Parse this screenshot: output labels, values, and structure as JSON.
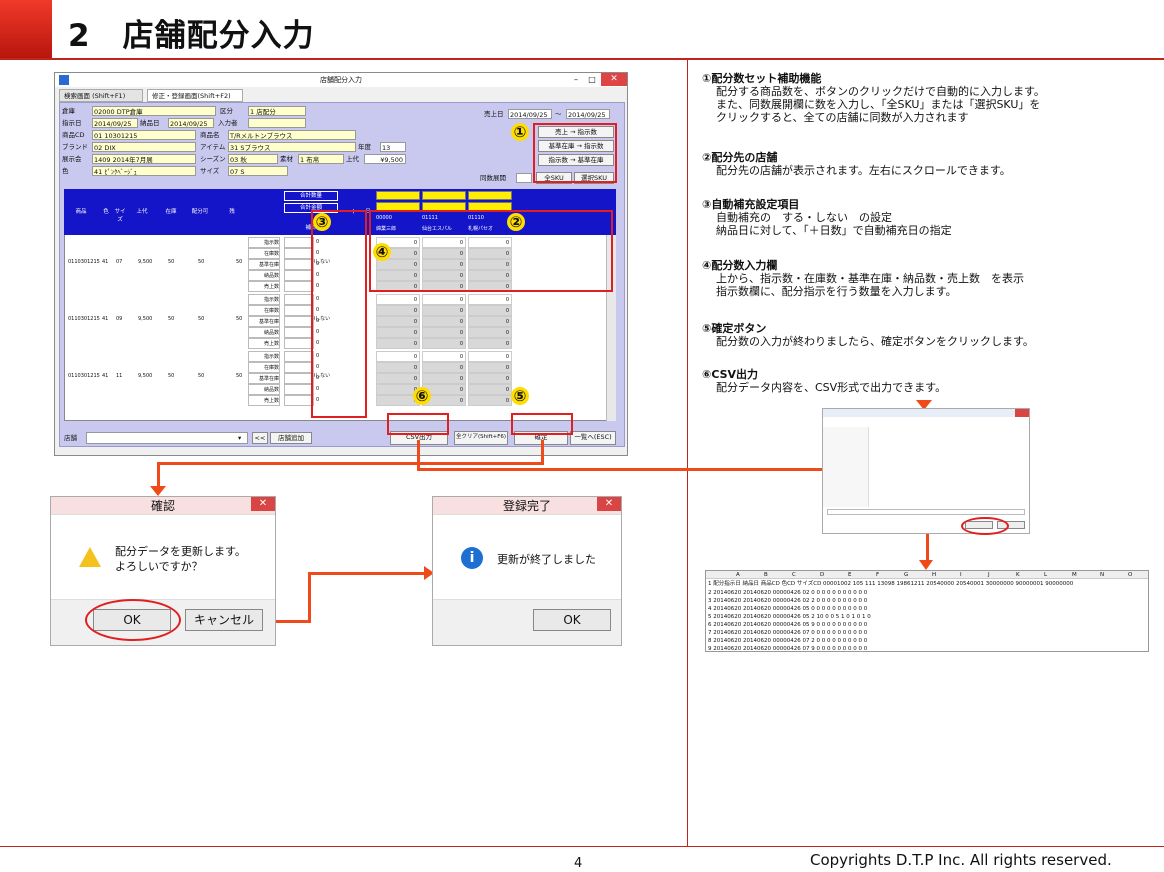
{
  "page": {
    "heading": "2　店舗配分入力",
    "page_number": "4",
    "copyright": "Copyrights  D.T.P Inc. All rights reserved."
  },
  "app": {
    "title": "店舗配分入力",
    "tabs": [
      "検索画面 (Shift+F1)",
      "修正・登録画面(Shift+F2)"
    ],
    "fields": {
      "warehouse_label": "倉庫",
      "warehouse_value": "02000 DTP倉庫",
      "category_label": "区分",
      "category_value": "1 店配分",
      "order_date_label": "指示日",
      "order_date_value": "2014/09/25",
      "delivery_label": "納品日",
      "delivery_value": "2014/09/25",
      "inputter_label": "入力者",
      "product_cd_label": "商品CD",
      "product_cd_value": "01 10301215",
      "product_name_label": "商品名",
      "product_name_value": "T/Rメルトンブラウス",
      "brand_label": "ブランド",
      "brand_value": "02 DIX",
      "item_label": "アイテム",
      "item_value": "31 Sブラウス",
      "year_label": "年度",
      "year_value": "13",
      "expo_label": "展示会",
      "expo_value": "1409 2014年7月展",
      "season_label": "シーズン",
      "season_value": "03 秋",
      "material_label": "素材",
      "material_value": "1 布帛",
      "price_label": "上代",
      "price_value": "¥9,500",
      "color_label": "色",
      "color_value": "41 ﾋﾟﾝｸﾍﾞｰｼﾞｭ",
      "size_label": "サイズ",
      "size_value": "07 S",
      "sales_date_label": "売上日",
      "sales_from": "2014/09/25",
      "sales_to": "2014/09/25",
      "tilde": "～"
    },
    "side_buttons": [
      "売上 → 指示数",
      "基準在庫 → 指示数",
      "指示数 → 基準在庫"
    ],
    "expand_label": "同数展開",
    "all_sku": "全SKU",
    "sel_sku": "選択SKU",
    "grid_headers": [
      "商品",
      "色",
      "サイズ",
      "上代",
      "在庫",
      "配分可",
      "残"
    ],
    "total_labels": [
      "合計数量",
      "合計金額",
      "補計"
    ],
    "auto_header": "自",
    "day_header": "日",
    "stores": [
      {
        "code": "00000",
        "name": "綿業三郎"
      },
      {
        "code": "01111",
        "name": "仙台エスパル"
      },
      {
        "code": "01110",
        "name": "札幌パセオ"
      }
    ],
    "row_labels": [
      "指示数",
      "在庫数",
      "基準在庫",
      "納品数",
      "売上数"
    ],
    "groups": [
      {
        "product": "0110301215",
        "color": "41",
        "size": "07",
        "price": "9,500",
        "stock": "50",
        "available": "50",
        "remain": "50",
        "auto": "0しない"
      },
      {
        "product": "0110301215",
        "color": "41",
        "size": "09",
        "price": "9,500",
        "stock": "50",
        "available": "50",
        "remain": "50",
        "auto": "0しない"
      },
      {
        "product": "0110301215",
        "color": "41",
        "size": "11",
        "price": "9,500",
        "stock": "50",
        "available": "50",
        "remain": "50",
        "auto": "0しない"
      }
    ],
    "zero": "0",
    "store_label": "店舗",
    "nav_prev": "<<",
    "add_store": "店舗追加",
    "csv_button": "CSV出力",
    "clear_button": "全クリア(Shift+F6)",
    "confirm_button": "確定",
    "back_button": "一覧へ(ESC)"
  },
  "markers": [
    "①",
    "②",
    "③",
    "④",
    "⑤",
    "⑥"
  ],
  "descriptions": [
    {
      "title": "①配分数セット補助機能",
      "lines": [
        "配分する商品数を、ボタンのクリックだけで自動的に入力します。",
        "また、同数展開欄に数を入力し、「全SKU」または「選択SKU」を",
        "クリックすると、全ての店舗に同数が入力されます"
      ]
    },
    {
      "title": "②配分先の店舗",
      "lines": [
        "配分先の店舗が表示されます。左右にスクロールできます。"
      ]
    },
    {
      "title": "③自動補充設定項目",
      "lines": [
        "自動補充の　する・しない　の設定",
        "納品日に対して、「＋日数」で自動補充日の指定"
      ]
    },
    {
      "title": "④配分数入力欄",
      "lines": [
        "上から、指示数・在庫数・基準在庫・納品数・売上数　を表示",
        "指示数欄に、配分指示を行う数量を入力します。"
      ]
    },
    {
      "title": "⑤確定ボタン",
      "lines": [
        "配分数の入力が終わりましたら、確定ボタンをクリックします。"
      ]
    },
    {
      "title": "⑥CSV出力",
      "lines": [
        "配分データ内容を、CSV形式で出力できます。"
      ]
    }
  ],
  "confirm_dialog": {
    "title": "確認",
    "message_1": "配分データを更新します。",
    "message_2": "よろしいですか？",
    "ok": "OK",
    "cancel": "キャンセル",
    "close": "✕"
  },
  "done_dialog": {
    "title": "登録完了",
    "message": "更新が終了しました",
    "ok": "OK",
    "close": "✕"
  },
  "spreadsheet": {
    "columns": [
      "A",
      "B",
      "C",
      "D",
      "E",
      "F",
      "G",
      "H",
      "I",
      "J",
      "K",
      "L",
      "M",
      "N",
      "O"
    ],
    "header_row": "1 配分指示日 納品日 商品CD 色CD サイズCD 00001002 105 111 13098 19861211 20540000 20540001 30000000 90000001 90000000",
    "rows": [
      "2 20140620 20140620 00000426 02 0 0 0 0 0 0 0 0 0 0 0",
      "3 20140620 20140620 00000426 02 2 0 0 0 0 0 0 0 0 0 0",
      "4 20140620 20140620 00000426 05 0 0 0 0 0 0 0 0 0 0 0",
      "5 20140620 20140620 00000426 05 2 10 0 0 5 1 0 1 0 1 0",
      "6 20140620 20140620 00000426 05 9 0 0 0 0 0 0 0 0 0 0",
      "7 20140620 20140620 00000426 07 0 0 0 0 0 0 0 0 0 0 0",
      "8 20140620 20140620 00000426 07 2 0 0 0 0 0 0 0 0 0 0",
      "9 20140620 20140620 00000426 07 9 0 0 0 0 0 0 0 0 0 0"
    ]
  },
  "colors": {
    "accent_red": "#c0241a",
    "arrow": "#f04a1a",
    "panel": "#c9c9ef",
    "grid_header": "#1414c8",
    "field": "#ffffcc"
  }
}
